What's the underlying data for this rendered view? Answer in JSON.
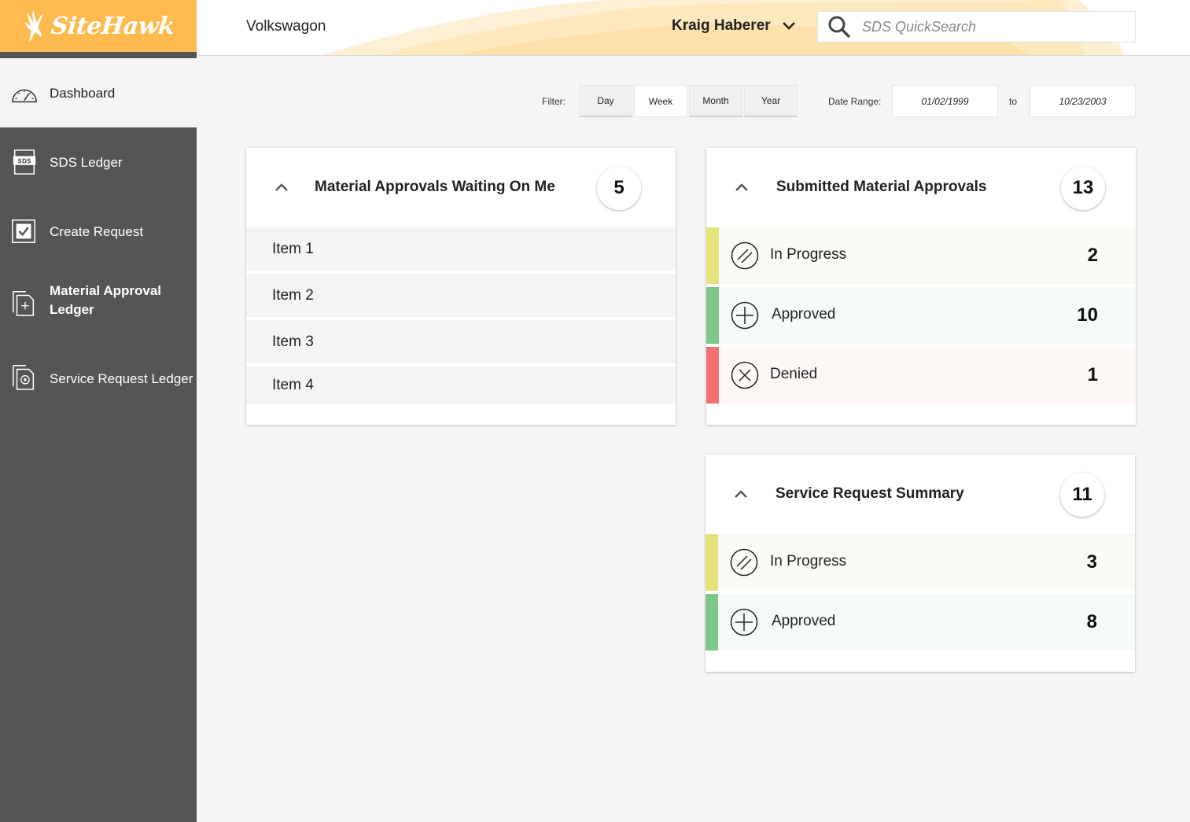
{
  "brand": {
    "name": "SiteHawk",
    "accent": "#fdbb4f",
    "sidebar_bg": "#555555"
  },
  "header": {
    "company": "Volkswagon",
    "user_name": "Kraig Haberer",
    "search_placeholder": "SDS QuickSearch"
  },
  "sidebar": {
    "items": [
      {
        "label": "Dashboard",
        "icon": "speedometer-icon"
      },
      {
        "label": "SDS Ledger",
        "icon": "sds-document-icon"
      },
      {
        "label": "Create Request",
        "icon": "checkbox-icon"
      },
      {
        "label": "Material Approval Ledger",
        "icon": "document-plus-icon"
      },
      {
        "label": "Service Request Ledger",
        "icon": "document-gear-icon"
      }
    ]
  },
  "filter": {
    "label": "Filter:",
    "options": [
      "Day",
      "Week",
      "Month",
      "Year"
    ],
    "selected": "Week",
    "date_range_label": "Date Range:",
    "from": "01/02/1999",
    "to_label": "to",
    "to": "10/23/2003"
  },
  "waiting_card": {
    "title": "Material Approvals Waiting On Me",
    "count": "5",
    "items": [
      "Item 1",
      "Item 2",
      "Item 3",
      "Item 4"
    ]
  },
  "submitted_card": {
    "title": "Submitted Material Approvals",
    "count": "13",
    "rows": [
      {
        "label": "In Progress",
        "count": "2",
        "color": "#e2e47a",
        "icon": "in-progress-icon"
      },
      {
        "label": "Approved",
        "count": "10",
        "color": "#7dc78a",
        "icon": "approved-plus-icon"
      },
      {
        "label": "Denied",
        "count": "1",
        "color": "#f27171",
        "icon": "denied-x-icon"
      }
    ]
  },
  "service_card": {
    "title": "Service Request Summary",
    "count": "11",
    "rows": [
      {
        "label": "In Progress",
        "count": "3",
        "color": "#e2e47a",
        "icon": "in-progress-icon"
      },
      {
        "label": "Approved",
        "count": "8",
        "color": "#7dc78a",
        "icon": "approved-plus-icon"
      }
    ]
  }
}
